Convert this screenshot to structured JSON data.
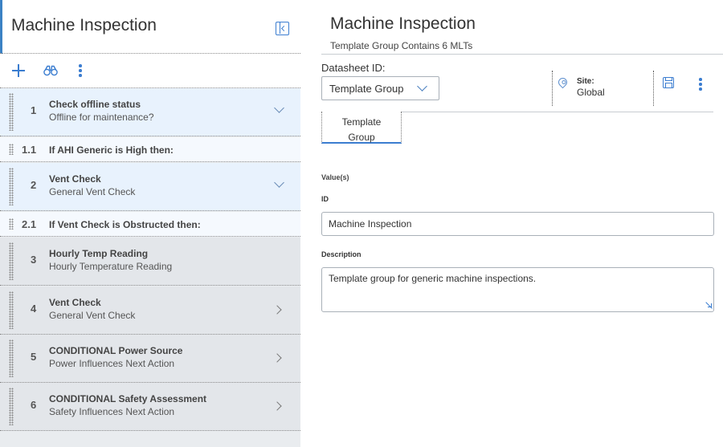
{
  "left_panel": {
    "title": "Machine Inspection",
    "toolbar": {
      "add_icon": "plus-icon",
      "search_icon": "binoculars-icon",
      "more_icon": "kebab-icon"
    },
    "items": [
      {
        "number": "1",
        "title": "Check offline status",
        "subtitle": "Offline for maintenance?",
        "state": "expanded"
      },
      {
        "number": "1.1",
        "text": "If AHI Generic is High then:"
      },
      {
        "number": "2",
        "title": "Vent Check",
        "subtitle": "General Vent Check",
        "state": "expanded"
      },
      {
        "number": "2.1",
        "text": "If Vent Check is Obstructed then:"
      },
      {
        "number": "3",
        "title": "Hourly Temp Reading",
        "subtitle": "Hourly Temperature Reading"
      },
      {
        "number": "4",
        "title": "Vent Check",
        "subtitle": "General Vent Check",
        "state": "collapsed"
      },
      {
        "number": "5",
        "title": "CONDITIONAL Power Source",
        "subtitle": "Power Influences Next Action",
        "state": "collapsed"
      },
      {
        "number": "6",
        "title": "CONDITIONAL Safety Assessment",
        "subtitle": "Safety Influences Next Action",
        "state": "collapsed"
      }
    ]
  },
  "right_panel": {
    "title": "Machine Inspection",
    "subtitle": "Template Group Contains 6 MLTs",
    "datasheet": {
      "label": "Datasheet ID:",
      "selected": "Template Group"
    },
    "site": {
      "label": "Site:",
      "value": "Global"
    },
    "tab": {
      "line1": "Template",
      "line2": "Group"
    },
    "values_label": "Value(s)",
    "id_field": {
      "label": "ID",
      "value": "Machine Inspection"
    },
    "description_field": {
      "label": "Description",
      "value": "Template group for generic machine inspections."
    }
  },
  "colors": {
    "accent": "#3b7dd0",
    "selected_row": "#e8f2fd",
    "inactive_row": "#e3e6ea"
  }
}
